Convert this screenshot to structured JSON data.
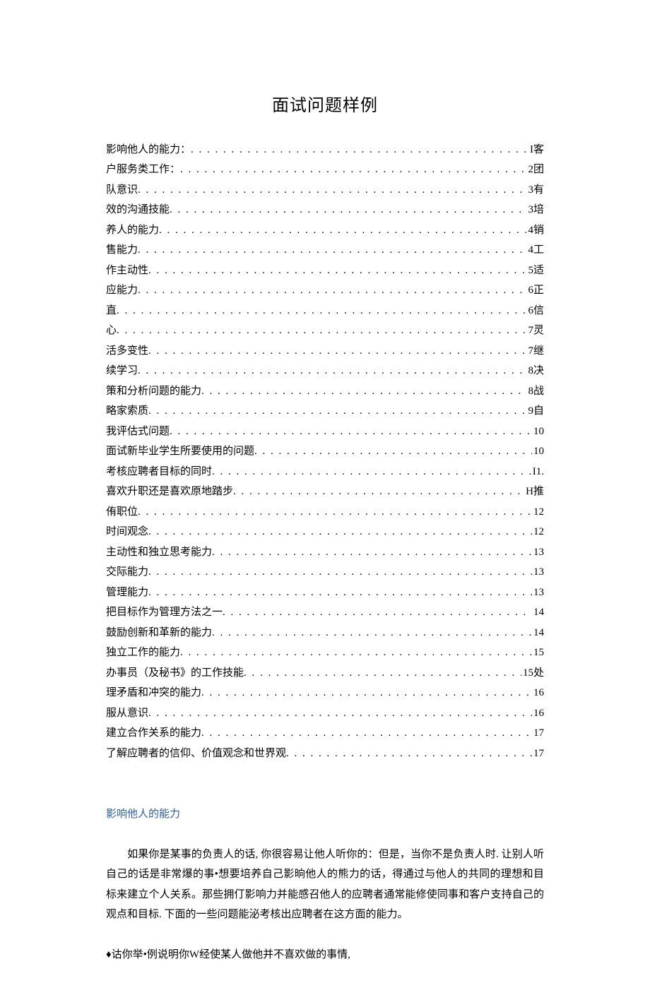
{
  "title": "面试问题样例",
  "toc": [
    {
      "label": "影响他人的能力：",
      "page": "I客"
    },
    {
      "label": "户服务类工作：",
      "page": "2团"
    },
    {
      "label": "队意识",
      "page": "3有"
    },
    {
      "label": "效的沟通技能",
      "page": "3培"
    },
    {
      "label": "养人的能力",
      "page": "4销"
    },
    {
      "label": "售能力",
      "page": "4工"
    },
    {
      "label": "作主动性",
      "page": "5适"
    },
    {
      "label": "应能力",
      "page": "6正"
    },
    {
      "label": "直",
      "page": "6信"
    },
    {
      "label": "心",
      "page": "7灵"
    },
    {
      "label": "活多变性",
      "page": "7继"
    },
    {
      "label": "续学习",
      "page": "8决"
    },
    {
      "label": "策和分析问题的能力",
      "page": "8战"
    },
    {
      "label": "略家索质",
      "page": "9自"
    },
    {
      "label": "我评估式问题",
      "page": "10"
    },
    {
      "label": "面试新毕业学生所要使用的问题",
      "page": "10"
    },
    {
      "label": "考核应聘者目标的同时",
      "page": "I1."
    },
    {
      "label": "喜欢升职还是喜欢原地踏步",
      "page": "H推"
    },
    {
      "label": "侑职位",
      "page": "12"
    },
    {
      "label": "时间观念",
      "page": "12"
    },
    {
      "label": "主动性和独立思考能力",
      "page": "13"
    },
    {
      "label": "交际能力",
      "page": "13"
    },
    {
      "label": "管理能力",
      "page": "13"
    },
    {
      "label": "把目标作为管理方法之一",
      "page": "14"
    },
    {
      "label": "鼓励创新和革新的能力",
      "page": "14"
    },
    {
      "label": "独立工作的能力",
      "page": "15"
    },
    {
      "label": "办事员（及秘书》的工作技能",
      "page": "15处"
    },
    {
      "label": "理矛盾和冲突的能力",
      "page": "16"
    },
    {
      "label": "服从意识",
      "page": "16"
    },
    {
      "label": "建立合作关系的能力",
      "page": "17"
    },
    {
      "label": "了解应聘者的信仰、价值观念和世界观",
      "page": "17"
    }
  ],
  "section_heading": "影响他人的能力",
  "body_para": "如果你是某事的负责人的话, 你很容易让他人听你的：但是，当你不是负责人时. 让别人听自己的话是非常爆的事•想要培养自己影晌他人的熊力的话，得通过与他人的共同的理想和目标来建立个人关系。那些拥仃影响力并能感召他人的应聘者通常能修使同事和客户支持自己的观点和目标. 下面的一些问题能泌考核出应聘者在这方面的能力。",
  "bullet_line": "♦诂你举•例说明你W经使某人做他并不喜欢做的事情,"
}
